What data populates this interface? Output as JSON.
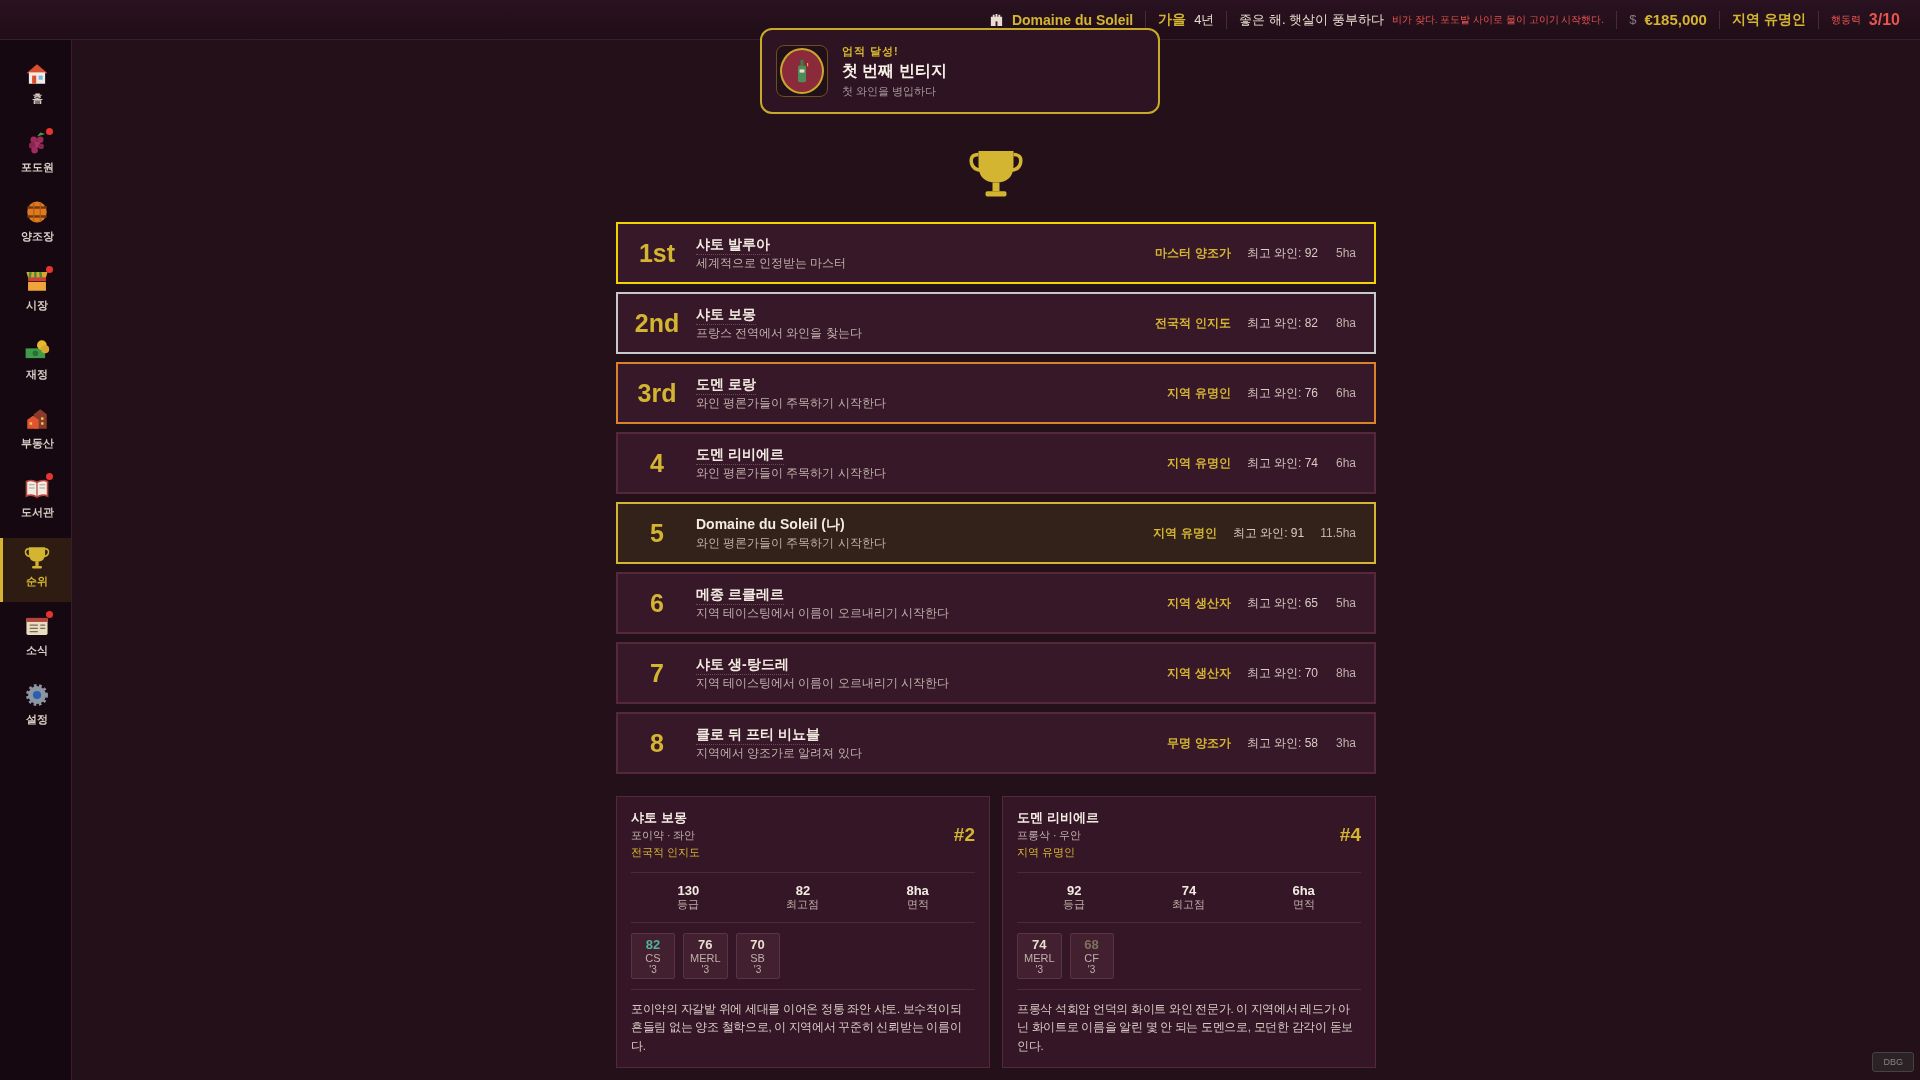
{
  "top_bar": {
    "estate": "Domaine du Soleil",
    "season": "가을",
    "year": "4년",
    "weather": "좋은 해. 햇살이 풍부하다",
    "event": "비가 잦다. 포도밭 사이로 물이 고이기 시작했다.",
    "currency_sign": "$",
    "money": "€185,000",
    "reputation": "지역 유명인",
    "action_label": "행동력",
    "action_value": "3/10"
  },
  "sidebar": {
    "items": [
      {
        "label": "홈",
        "selected": false,
        "badge": false
      },
      {
        "label": "포도원",
        "selected": false,
        "badge": true
      },
      {
        "label": "양조장",
        "selected": false,
        "badge": false
      },
      {
        "label": "시장",
        "selected": false,
        "badge": true
      },
      {
        "label": "재정",
        "selected": false,
        "badge": false
      },
      {
        "label": "부동산",
        "selected": false,
        "badge": false
      },
      {
        "label": "도서관",
        "selected": false,
        "badge": true
      },
      {
        "label": "순위",
        "selected": true,
        "badge": false
      },
      {
        "label": "소식",
        "selected": false,
        "badge": true
      },
      {
        "label": "설정",
        "selected": false,
        "badge": false
      }
    ]
  },
  "toast": {
    "heading": "업적 달성!",
    "title": "첫 번째 빈티지",
    "text": "첫 와인을 병입하다"
  },
  "rankings": [
    {
      "rank": "1st",
      "color": "#f2d200",
      "player": false,
      "name": "샤토 발루아",
      "motto": "세계적으로 인정받는 마스터",
      "tier": "마스터 양조가",
      "best": "최고 와인: 92",
      "area": "5ha"
    },
    {
      "rank": "2nd",
      "color": "#c8c8cc",
      "player": false,
      "name": "샤토 보몽",
      "motto": "프랑스 전역에서 와인을 찾는다",
      "tier": "전국적 인지도",
      "best": "최고 와인: 82",
      "area": "8ha"
    },
    {
      "rank": "3rd",
      "color": "#d9822b",
      "player": false,
      "name": "도멘 로랑",
      "motto": "와인 평론가들이 주목하기 시작한다",
      "tier": "지역 유명인",
      "best": "최고 와인: 76",
      "area": "6ha"
    },
    {
      "rank": "4",
      "color": "#56283b",
      "player": false,
      "name": "도멘 리비에르",
      "motto": "와인 평론가들이 주목하기 시작한다",
      "tier": "지역 유명인",
      "best": "최고 와인: 74",
      "area": "6ha"
    },
    {
      "rank": "5",
      "color": "#d4b531",
      "player": true,
      "name": "Domaine du Soleil (나)",
      "motto": "와인 평론가들이 주목하기 시작한다",
      "tier": "지역 유명인",
      "best": "최고 와인: 91",
      "area": "11.5ha"
    },
    {
      "rank": "6",
      "color": "#56283b",
      "player": false,
      "name": "메종 르클레르",
      "motto": "지역 테이스팅에서 이름이 오르내리기 시작한다",
      "tier": "지역 생산자",
      "best": "최고 와인: 65",
      "area": "5ha"
    },
    {
      "rank": "7",
      "color": "#56283b",
      "player": false,
      "name": "샤토 생-탕드레",
      "motto": "지역 테이스팅에서 이름이 오르내리기 시작한다",
      "tier": "지역 생산자",
      "best": "최고 와인: 70",
      "area": "8ha"
    },
    {
      "rank": "8",
      "color": "#56283b",
      "player": false,
      "name": "클로 뒤 프티 비뇨블",
      "motto": "지역에서 양조가로 알려져 있다",
      "tier": "무명 양조가",
      "best": "최고 와인: 58",
      "area": "3ha"
    }
  ],
  "rival_cards": [
    {
      "name": "샤토 보몽",
      "region": "포이약 · 좌안",
      "tier": "전국적 인지도",
      "rank": "#2",
      "stats": [
        {
          "value": "130",
          "label": "등급"
        },
        {
          "value": "82",
          "label": "최고점"
        },
        {
          "value": "8ha",
          "label": "면적"
        }
      ],
      "wines": [
        {
          "score": "82",
          "grape": "CS",
          "year": "'3",
          "color": "#4fb3a0"
        },
        {
          "score": "76",
          "grape": "MERL",
          "year": "'3",
          "color": "#e8ddd0"
        },
        {
          "score": "70",
          "grape": "SB",
          "year": "'3",
          "color": "#e8ddd0"
        }
      ],
      "description": "포이약의 자갈밭 위에 세대를 이어온 정통 좌안 샤토. 보수적이되 흔들림 없는 양조 철학으로, 이 지역에서 꾸준히 신뢰받는 이름이다."
    },
    {
      "name": "도멘 리비에르",
      "region": "프롱삭 · 우안",
      "tier": "지역 유명인",
      "rank": "#4",
      "stats": [
        {
          "value": "92",
          "label": "등급"
        },
        {
          "value": "74",
          "label": "최고점"
        },
        {
          "value": "6ha",
          "label": "면적"
        }
      ],
      "wines": [
        {
          "score": "74",
          "grape": "MERL",
          "year": "'3",
          "color": "#e8ddd0"
        },
        {
          "score": "68",
          "grape": "CF",
          "year": "'3",
          "color": "#7d7160"
        }
      ],
      "description": "프롱삭 석회암 언덕의 화이트 와인 전문가. 이 지역에서 레드가 아닌 화이트로 이름을 알린 몇 안 되는 도멘으로, 모던한 감각이 돋보인다."
    }
  ],
  "debug_button": "DBG"
}
